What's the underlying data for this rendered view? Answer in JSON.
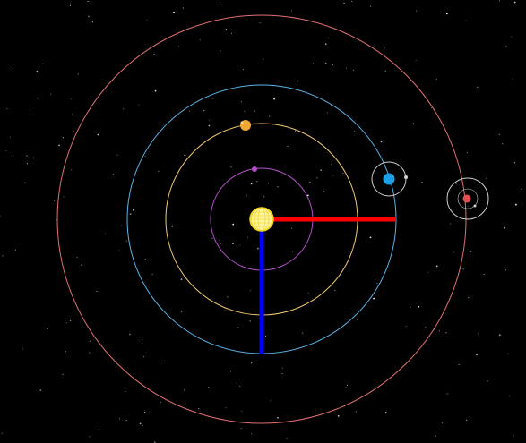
{
  "scene": {
    "background": "#000000",
    "star_color": "#ffffff",
    "sun": {
      "icon": "sun-icon",
      "fill": "#fff4a0",
      "stroke": "#f2d21a"
    },
    "axes": {
      "x_axis_color": "#ff0000",
      "y_axis_color": "#0000ff"
    },
    "planets": [
      {
        "name": "planet-1",
        "orbit_color": "#b24fc7",
        "color": "#b24fc7",
        "icon": "planet-icon"
      },
      {
        "name": "planet-2",
        "orbit_color": "#f0c870",
        "color": "#f0a830",
        "icon": "planet-icon"
      },
      {
        "name": "planet-3",
        "orbit_color": "#5ab4e8",
        "color": "#1ea0e6",
        "icon": "planet-icon",
        "moon": {
          "orbit_color": "#d0d0d0",
          "color": "#d0d0d0",
          "icon": "moon-icon"
        }
      },
      {
        "name": "planet-4",
        "orbit_color": "#e07070",
        "color": "#e05050",
        "icon": "planet-icon",
        "moon": {
          "orbit_color": "#d0d0d0",
          "color": "#d0d0d0",
          "icon": "moon-icon"
        }
      }
    ]
  }
}
